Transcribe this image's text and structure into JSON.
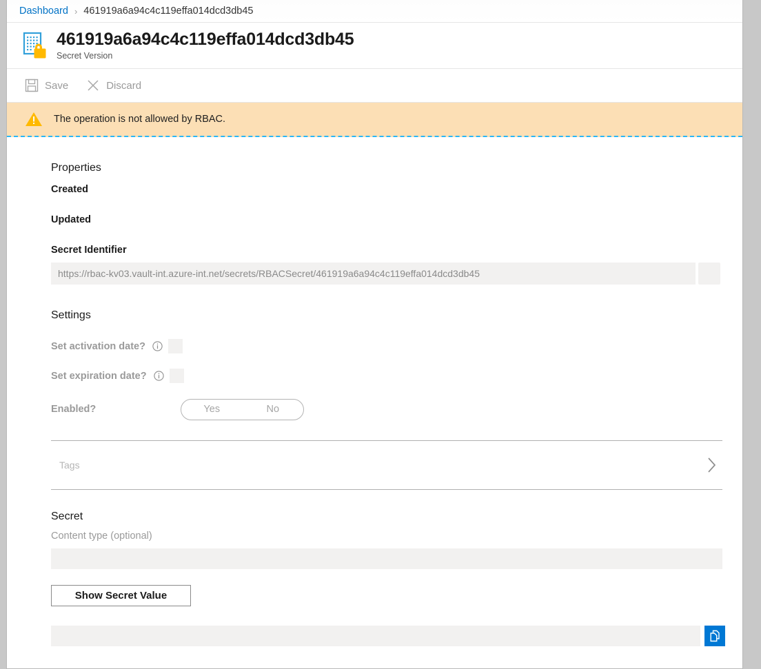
{
  "breadcrumb": {
    "home_label": "Dashboard",
    "separator": "›",
    "current_label": "461919a6a94c4c119effa014dcd3db45"
  },
  "header": {
    "title": "461919a6a94c4c119effa014dcd3db45",
    "subtitle": "Secret Version",
    "icon": "secret-version-icon"
  },
  "toolbar": {
    "save_label": "Save",
    "save_icon": "save-floppy-icon",
    "discard_label": "Discard",
    "discard_icon": "close-x-icon",
    "enabled": false
  },
  "notification": {
    "icon": "warning-triangle-icon",
    "message": "The operation is not allowed by RBAC.",
    "background": "#fcdfb5",
    "icon_color": "#ffb900",
    "accent_border": "#29b6f6"
  },
  "properties": {
    "heading": "Properties",
    "created_label": "Created",
    "created_value": "",
    "updated_label": "Updated",
    "updated_value": "",
    "secret_identifier_label": "Secret Identifier",
    "secret_identifier_value": "https://rbac-kv03.vault-int.azure-int.net/secrets/RBACSecret/461919a6a94c4c119effa014dcd3db45",
    "copy_identifier_icon": "copy-icon"
  },
  "settings": {
    "heading": "Settings",
    "activation_label": "Set activation date?",
    "activation_info_icon": "info-icon",
    "activation_checked": false,
    "expiration_label": "Set expiration date?",
    "expiration_info_icon": "info-icon",
    "expiration_checked": false,
    "enabled_label": "Enabled?",
    "enabled_yes": "Yes",
    "enabled_no": "No",
    "enabled_selected": ""
  },
  "tags": {
    "label": "Tags",
    "chevron_icon": "chevron-right-icon"
  },
  "secret": {
    "heading": "Secret",
    "content_type_label": "Content type (optional)",
    "content_type_value": "",
    "show_value_button": "Show Secret Value",
    "secret_value": "",
    "copy_icon": "copy-icon",
    "copy_button_color": "#0078d4"
  },
  "theme": {
    "link_color": "#0072c6",
    "text_color": "#1a1a1a",
    "muted_color": "#9a9a9a",
    "disabled_field_bg": "#f2f1f0",
    "icon_blue": "#32a0da",
    "icon_gold": "#ffb900"
  }
}
